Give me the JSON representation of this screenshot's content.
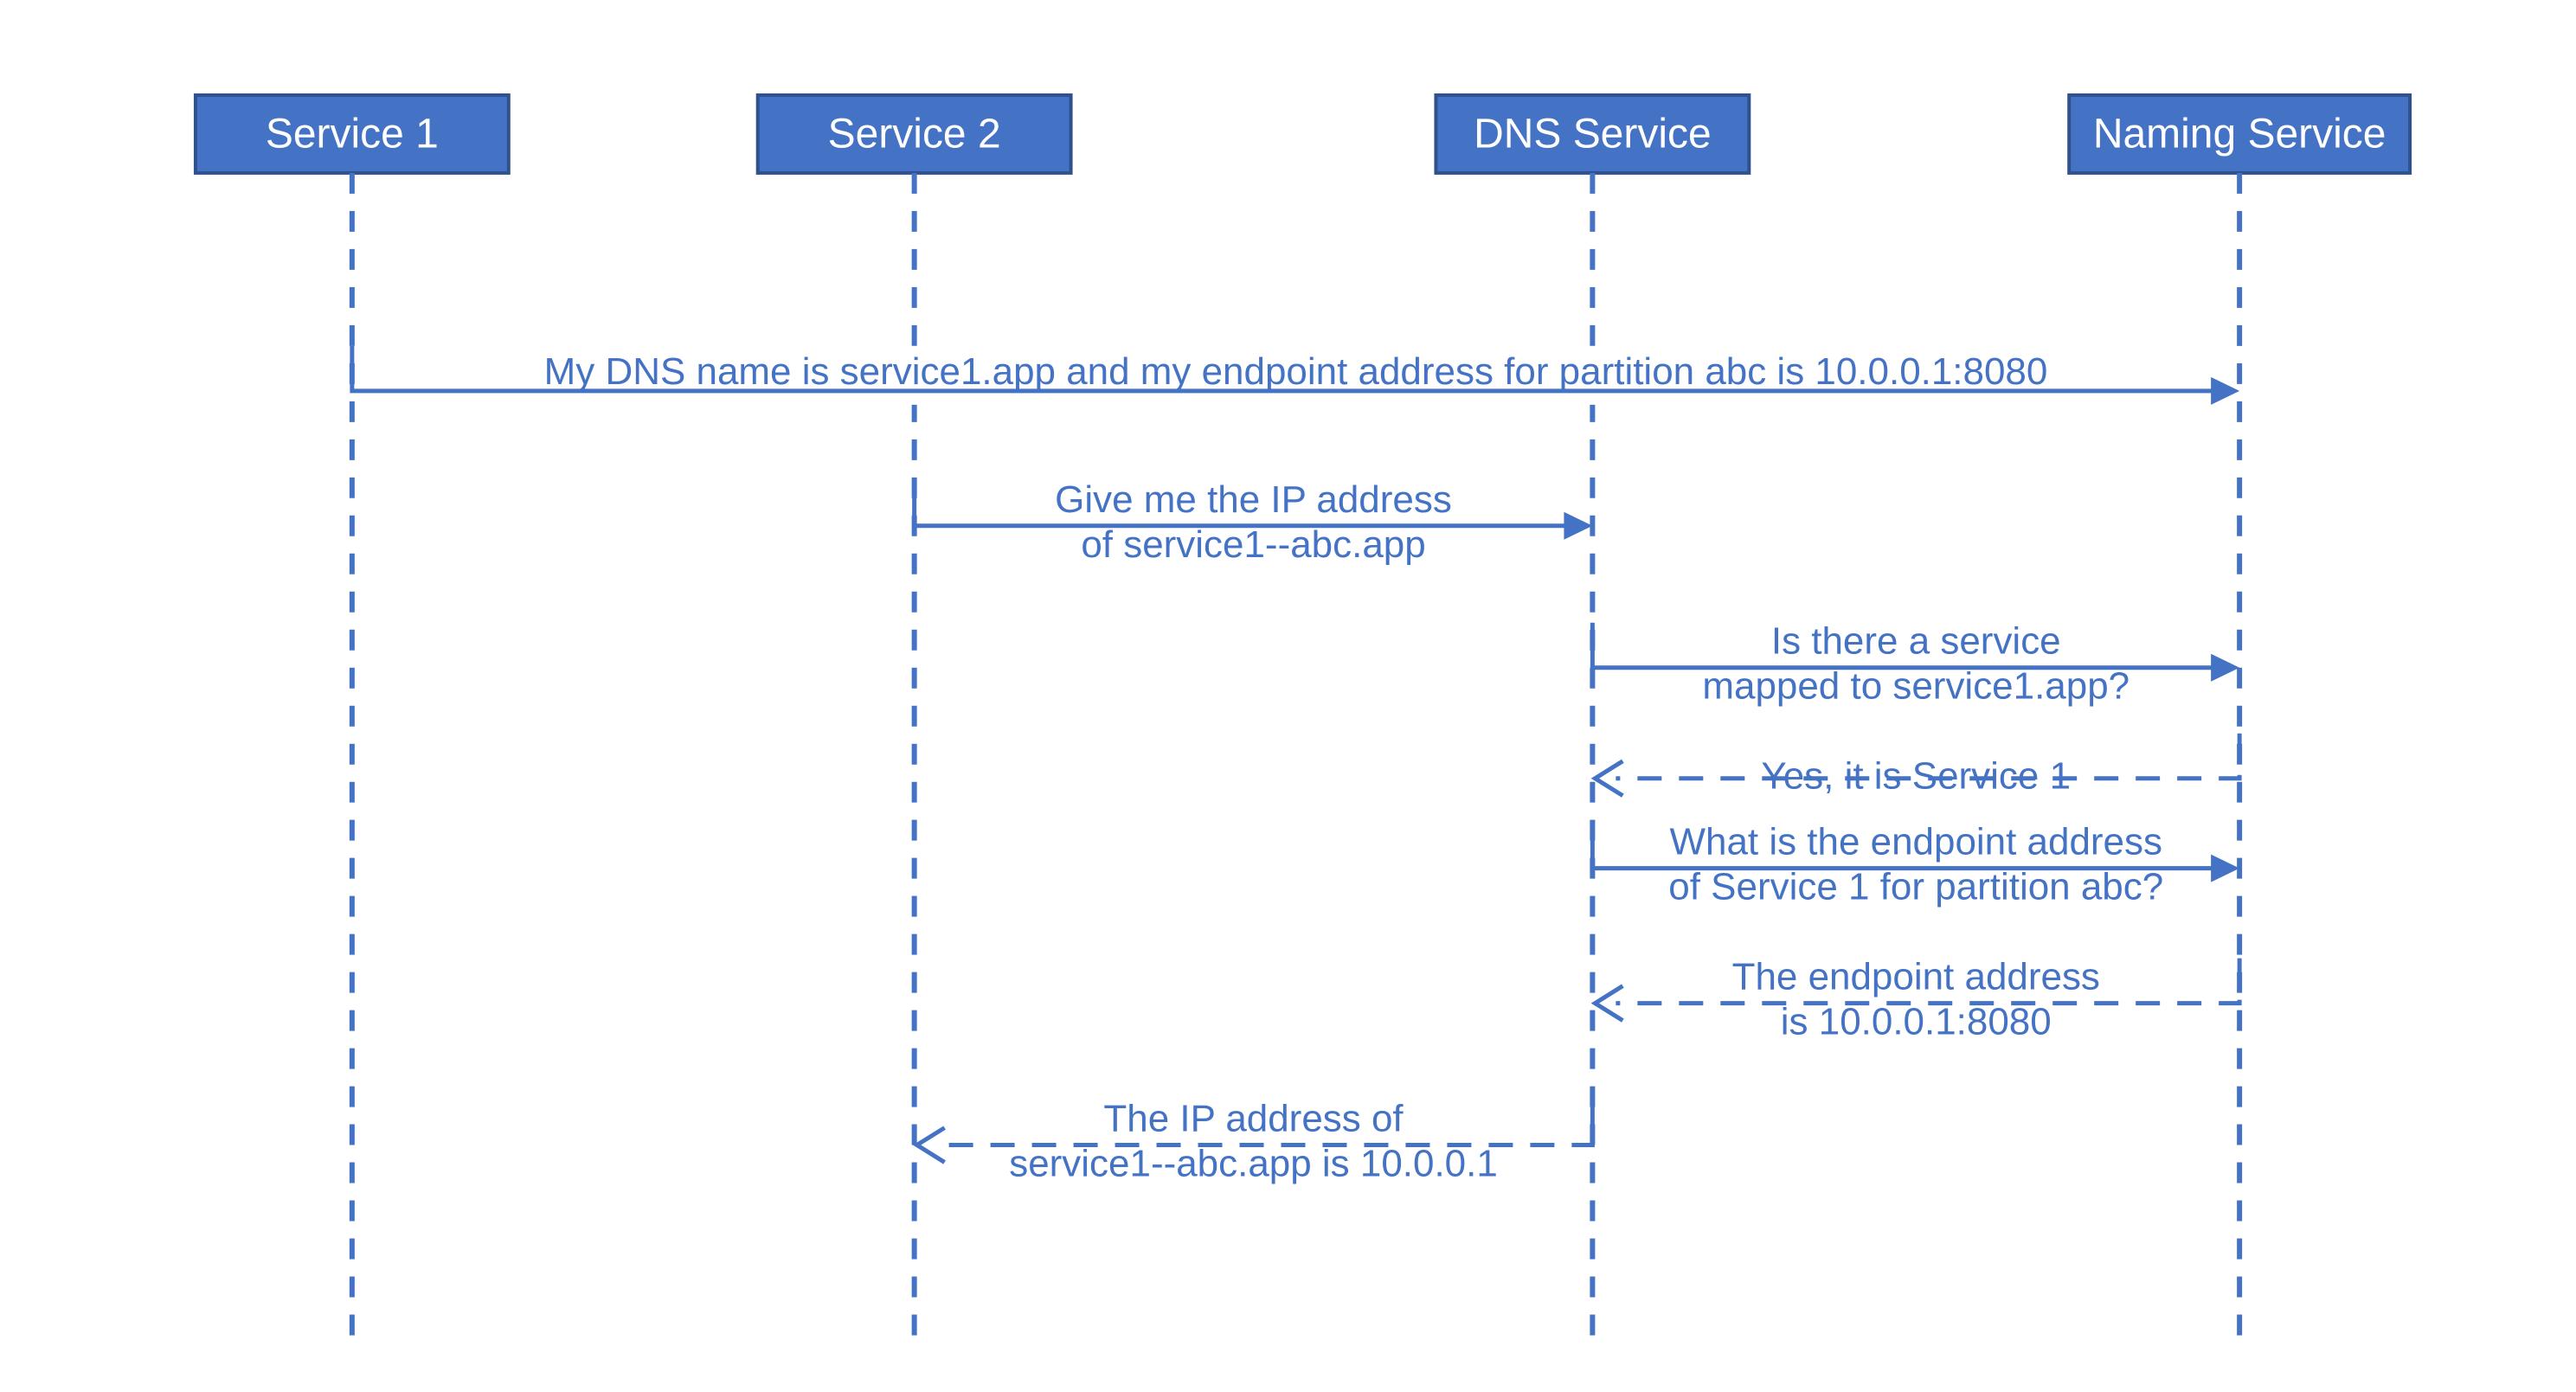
{
  "participants": [
    {
      "id": "service1",
      "label": "Service 1"
    },
    {
      "id": "service2",
      "label": "Service 2"
    },
    {
      "id": "dns",
      "label": "DNS Service"
    },
    {
      "id": "naming",
      "label": "Naming Service"
    }
  ],
  "messages": {
    "m1": {
      "line1": "My DNS name is service1.app and my endpoint address for partition abc is 10.0.0.1:8080"
    },
    "m2": {
      "line1": "Give me the IP address",
      "line2": "of service1--abc.app"
    },
    "m3": {
      "line1": "Is there a service",
      "line2": "mapped to service1.app?"
    },
    "m4": {
      "line1": "Yes, it is Service 1"
    },
    "m5": {
      "line1": "What is the endpoint address",
      "line2": "of Service 1 for partition abc?"
    },
    "m6": {
      "line1": "The endpoint address",
      "line2": "is 10.0.0.1:8080"
    },
    "m7": {
      "line1": "The IP address of",
      "line2": "service1--abc.app is 10.0.0.1"
    }
  }
}
